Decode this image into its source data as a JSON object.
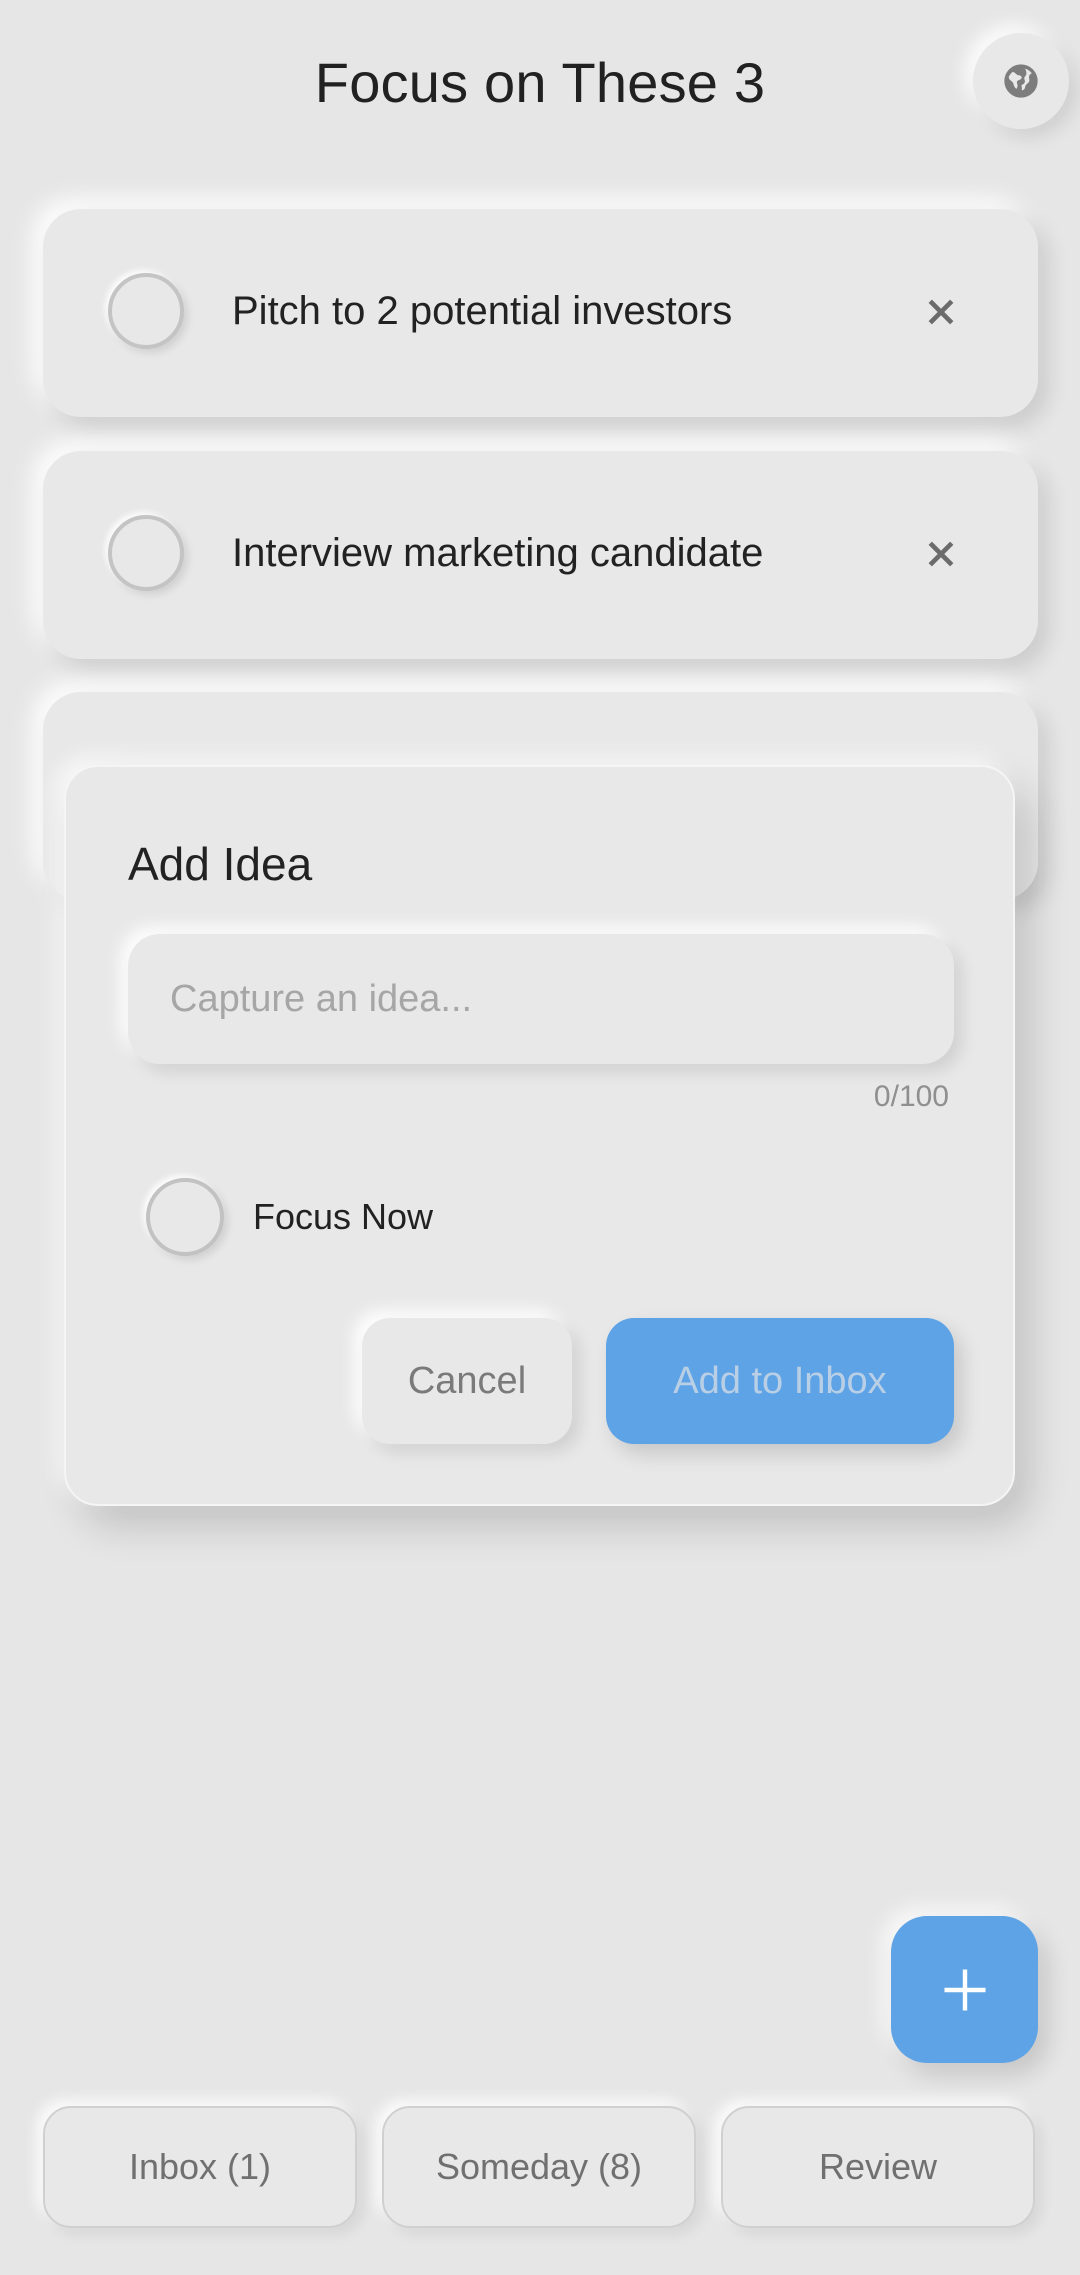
{
  "header": {
    "title": "Focus on These 3",
    "language_icon": "globe-icon"
  },
  "tasks": [
    {
      "text": "Pitch to 2 potential investors",
      "checked": false
    },
    {
      "text": "Interview marketing candidate",
      "checked": false
    },
    {
      "text": "",
      "checked": false
    }
  ],
  "dialog": {
    "title": "Add Idea",
    "input_value": "",
    "input_placeholder": "Capture an idea...",
    "char_counter": "0/100",
    "focus_label": "Focus Now",
    "focus_checked": false,
    "cancel_label": "Cancel",
    "submit_label": "Add to Inbox"
  },
  "fab": {
    "icon": "plus-icon"
  },
  "bottom_nav": {
    "inbox_label": "Inbox (1)",
    "someday_label": "Someday (8)",
    "review_label": "Review"
  },
  "colors": {
    "background": "#e6e6e6",
    "accent": "#5ea3e6",
    "text": "#222222",
    "muted": "#7a7a7a"
  }
}
